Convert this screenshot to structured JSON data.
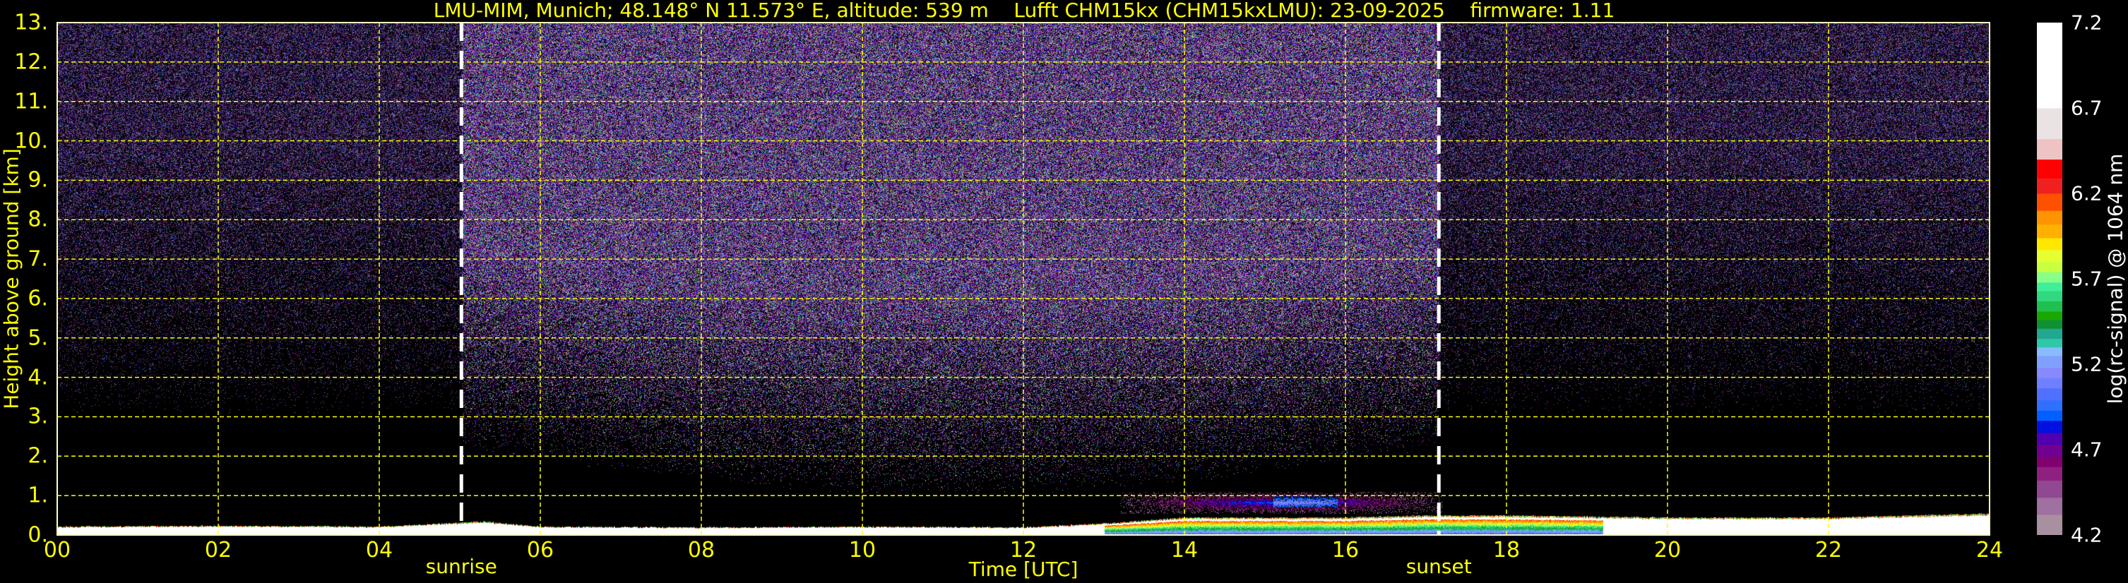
{
  "chart_data": {
    "type": "heatmap",
    "title": "LMU-MIM, Munich; 48.148° N 11.573° E, altitude: 539 m    Lufft CHM15kx (CHM15kxLMU): 23-09-2025    firmware: 1.11",
    "xlabel": "Time [UTC]",
    "ylabel": "Height above ground [km]",
    "xlim": [
      0,
      24
    ],
    "ylim": [
      0,
      13
    ],
    "x_ticks": [
      "00",
      "02",
      "04",
      "06",
      "08",
      "10",
      "12",
      "14",
      "16",
      "18",
      "20",
      "22",
      "24"
    ],
    "x_tick_values": [
      0,
      2,
      4,
      6,
      8,
      10,
      12,
      14,
      16,
      18,
      20,
      22,
      24
    ],
    "y_ticks": [
      "0.",
      "1.",
      "2.",
      "3.",
      "4.",
      "5.",
      "6.",
      "7.",
      "8.",
      "9.",
      "10.",
      "11.",
      "12.",
      "13."
    ],
    "y_tick_values": [
      0,
      1,
      2,
      3,
      4,
      5,
      6,
      7,
      8,
      9,
      10,
      11,
      12,
      13
    ],
    "grid": true,
    "grid_color": "#ffff00",
    "events": [
      {
        "label": "sunrise",
        "time_h": 5.02
      },
      {
        "label": "sunset",
        "time_h": 17.16
      }
    ],
    "boundary_layer_top_km": [
      [
        0,
        0.22
      ],
      [
        2,
        0.24
      ],
      [
        4,
        0.22
      ],
      [
        5.3,
        0.35
      ],
      [
        6,
        0.22
      ],
      [
        8,
        0.2
      ],
      [
        10,
        0.22
      ],
      [
        12,
        0.2
      ],
      [
        13,
        0.3
      ],
      [
        14,
        0.45
      ],
      [
        16,
        0.45
      ],
      [
        17,
        0.5
      ],
      [
        18,
        0.5
      ],
      [
        20,
        0.45
      ],
      [
        22,
        0.45
      ],
      [
        24,
        0.55
      ]
    ],
    "aerosol_layer": {
      "start_h": 13.2,
      "end_h": 17.2,
      "base_km": 0.55,
      "top_km": 1.1
    },
    "colorbar": {
      "label": "log(rc-signal) @ 1064 nm",
      "range": [
        4.2,
        7.2
      ],
      "ticks": [
        "4.2",
        "4.7",
        "5.2",
        "5.7",
        "6.2",
        "6.7",
        "7.2"
      ],
      "tick_values": [
        4.2,
        4.7,
        5.2,
        5.7,
        6.2,
        6.7,
        7.2
      ],
      "bounds": [
        4.2,
        4.32,
        4.42,
        4.52,
        4.6,
        4.66,
        4.73,
        4.8,
        4.87,
        4.93,
        4.99,
        5.06,
        5.12,
        5.18,
        5.25,
        5.3,
        5.35,
        5.41,
        5.46,
        5.51,
        5.57,
        5.63,
        5.68,
        5.74,
        5.8,
        5.87,
        5.94,
        6.02,
        6.1,
        6.2,
        6.29,
        6.4,
        6.52,
        6.7,
        7.2
      ],
      "colors": [
        "#a890a0",
        "#a070a0",
        "#904890",
        "#902080",
        "#800070",
        "#700090",
        "#5000b0",
        "#0010e0",
        "#0060ff",
        "#3070ff",
        "#5070ff",
        "#6e80ff",
        "#8888ff",
        "#80a0ff",
        "#88bbff",
        "#30c8a8",
        "#20a890",
        "#109030",
        "#18a800",
        "#20c050",
        "#30d880",
        "#40ee99",
        "#88ff88",
        "#c8ff40",
        "#e6ff30",
        "#ffe800",
        "#ffb000",
        "#ff9400",
        "#ff5000",
        "#f02020",
        "#ff0000",
        "#efc3c3",
        "#ebe3e3",
        "#ffffff"
      ]
    }
  }
}
